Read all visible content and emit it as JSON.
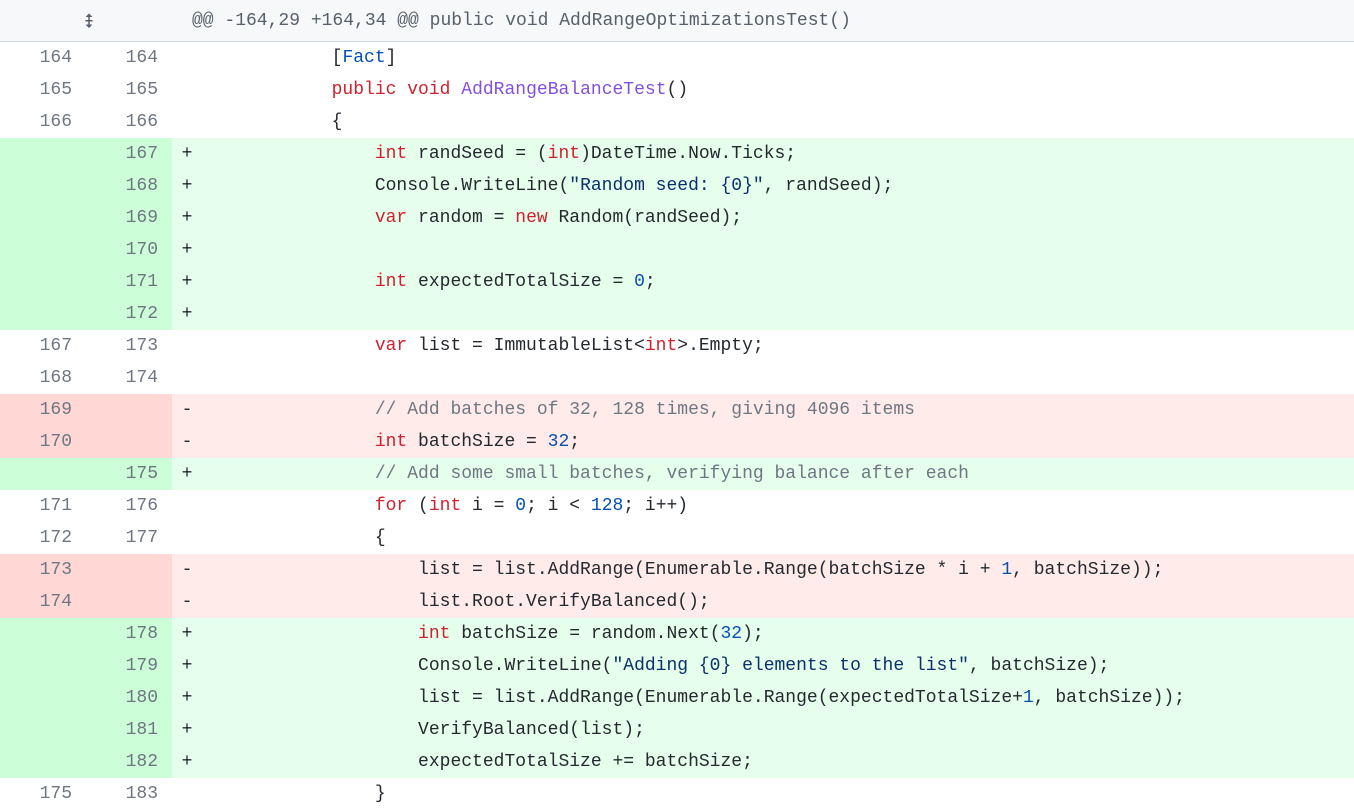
{
  "hunk_header": "@@ -164,29 +164,34 @@ public void AddRangeOptimizationsTest()",
  "rows": [
    {
      "t": "ctx",
      "l": "164",
      "r": "164",
      "m": " ",
      "seg": [
        [
          "pl",
          "            ["
        ],
        [
          "ty",
          "Fact"
        ],
        [
          "pl",
          "]"
        ]
      ]
    },
    {
      "t": "ctx",
      "l": "165",
      "r": "165",
      "m": " ",
      "seg": [
        [
          "pl",
          "            "
        ],
        [
          "kw",
          "public"
        ],
        [
          "pl",
          " "
        ],
        [
          "kw",
          "void"
        ],
        [
          "pl",
          " "
        ],
        [
          "fn",
          "AddRangeBalanceTest"
        ],
        [
          "pl",
          "()"
        ]
      ]
    },
    {
      "t": "ctx",
      "l": "166",
      "r": "166",
      "m": " ",
      "seg": [
        [
          "pl",
          "            {"
        ]
      ]
    },
    {
      "t": "add",
      "l": "",
      "r": "167",
      "m": "+",
      "seg": [
        [
          "pl",
          "                "
        ],
        [
          "kw",
          "int"
        ],
        [
          "pl",
          " randSeed = ("
        ],
        [
          "kw",
          "int"
        ],
        [
          "pl",
          ")DateTime.Now.Ticks;"
        ]
      ]
    },
    {
      "t": "add",
      "l": "",
      "r": "168",
      "m": "+",
      "seg": [
        [
          "pl",
          "                Console.WriteLine("
        ],
        [
          "str",
          "\"Random seed: {0}\""
        ],
        [
          "pl",
          ", randSeed);"
        ]
      ]
    },
    {
      "t": "add",
      "l": "",
      "r": "169",
      "m": "+",
      "seg": [
        [
          "pl",
          "                "
        ],
        [
          "kw",
          "var"
        ],
        [
          "pl",
          " random = "
        ],
        [
          "kw",
          "new"
        ],
        [
          "pl",
          " Random(randSeed);"
        ]
      ]
    },
    {
      "t": "add",
      "l": "",
      "r": "170",
      "m": "+",
      "seg": [
        [
          "pl",
          ""
        ]
      ]
    },
    {
      "t": "add",
      "l": "",
      "r": "171",
      "m": "+",
      "seg": [
        [
          "pl",
          "                "
        ],
        [
          "kw",
          "int"
        ],
        [
          "pl",
          " expectedTotalSize = "
        ],
        [
          "ty",
          "0"
        ],
        [
          "pl",
          ";"
        ]
      ]
    },
    {
      "t": "add",
      "l": "",
      "r": "172",
      "m": "+",
      "seg": [
        [
          "pl",
          ""
        ]
      ]
    },
    {
      "t": "ctx",
      "l": "167",
      "r": "173",
      "m": " ",
      "seg": [
        [
          "pl",
          "                "
        ],
        [
          "kw",
          "var"
        ],
        [
          "pl",
          " list = ImmutableList<"
        ],
        [
          "kw",
          "int"
        ],
        [
          "pl",
          ">.Empty;"
        ]
      ]
    },
    {
      "t": "ctx",
      "l": "168",
      "r": "174",
      "m": " ",
      "seg": [
        [
          "pl",
          ""
        ]
      ]
    },
    {
      "t": "del",
      "l": "169",
      "r": "",
      "m": "-",
      "seg": [
        [
          "pl",
          "                "
        ],
        [
          "cm",
          "// Add batches of 32, 128 times, giving 4096 items"
        ]
      ]
    },
    {
      "t": "del",
      "l": "170",
      "r": "",
      "m": "-",
      "seg": [
        [
          "pl",
          "                "
        ],
        [
          "kw",
          "int"
        ],
        [
          "pl",
          " batchSize = "
        ],
        [
          "ty",
          "32"
        ],
        [
          "pl",
          ";"
        ]
      ]
    },
    {
      "t": "add",
      "l": "",
      "r": "175",
      "m": "+",
      "seg": [
        [
          "pl",
          "                "
        ],
        [
          "cm",
          "// Add some small batches, verifying balance after each"
        ]
      ]
    },
    {
      "t": "ctx",
      "l": "171",
      "r": "176",
      "m": " ",
      "seg": [
        [
          "pl",
          "                "
        ],
        [
          "kw",
          "for"
        ],
        [
          "pl",
          " ("
        ],
        [
          "kw",
          "int"
        ],
        [
          "pl",
          " i = "
        ],
        [
          "ty",
          "0"
        ],
        [
          "pl",
          "; i < "
        ],
        [
          "ty",
          "128"
        ],
        [
          "pl",
          "; i++)"
        ]
      ]
    },
    {
      "t": "ctx",
      "l": "172",
      "r": "177",
      "m": " ",
      "seg": [
        [
          "pl",
          "                {"
        ]
      ]
    },
    {
      "t": "del",
      "l": "173",
      "r": "",
      "m": "-",
      "seg": [
        [
          "pl",
          "                    list = list.AddRange(Enumerable.Range(batchSize * i + "
        ],
        [
          "ty",
          "1"
        ],
        [
          "pl",
          ", batchSize));"
        ]
      ]
    },
    {
      "t": "del",
      "l": "174",
      "r": "",
      "m": "-",
      "seg": [
        [
          "pl",
          "                    list.Root.VerifyBalanced();"
        ]
      ]
    },
    {
      "t": "add",
      "l": "",
      "r": "178",
      "m": "+",
      "seg": [
        [
          "pl",
          "                    "
        ],
        [
          "kw",
          "int"
        ],
        [
          "pl",
          " batchSize = random.Next("
        ],
        [
          "ty",
          "32"
        ],
        [
          "pl",
          ");"
        ]
      ]
    },
    {
      "t": "add",
      "l": "",
      "r": "179",
      "m": "+",
      "seg": [
        [
          "pl",
          "                    Console.WriteLine("
        ],
        [
          "str",
          "\"Adding {0} elements to the list\""
        ],
        [
          "pl",
          ", batchSize);"
        ]
      ]
    },
    {
      "t": "add",
      "l": "",
      "r": "180",
      "m": "+",
      "seg": [
        [
          "pl",
          "                    list = list.AddRange(Enumerable.Range(expectedTotalSize+"
        ],
        [
          "ty",
          "1"
        ],
        [
          "pl",
          ", batchSize));"
        ]
      ]
    },
    {
      "t": "add",
      "l": "",
      "r": "181",
      "m": "+",
      "seg": [
        [
          "pl",
          "                    VerifyBalanced(list);"
        ]
      ]
    },
    {
      "t": "add",
      "l": "",
      "r": "182",
      "m": "+",
      "seg": [
        [
          "pl",
          "                    expectedTotalSize += batchSize;"
        ]
      ]
    },
    {
      "t": "ctx",
      "l": "175",
      "r": "183",
      "m": " ",
      "seg": [
        [
          "pl",
          "                }"
        ]
      ]
    }
  ]
}
